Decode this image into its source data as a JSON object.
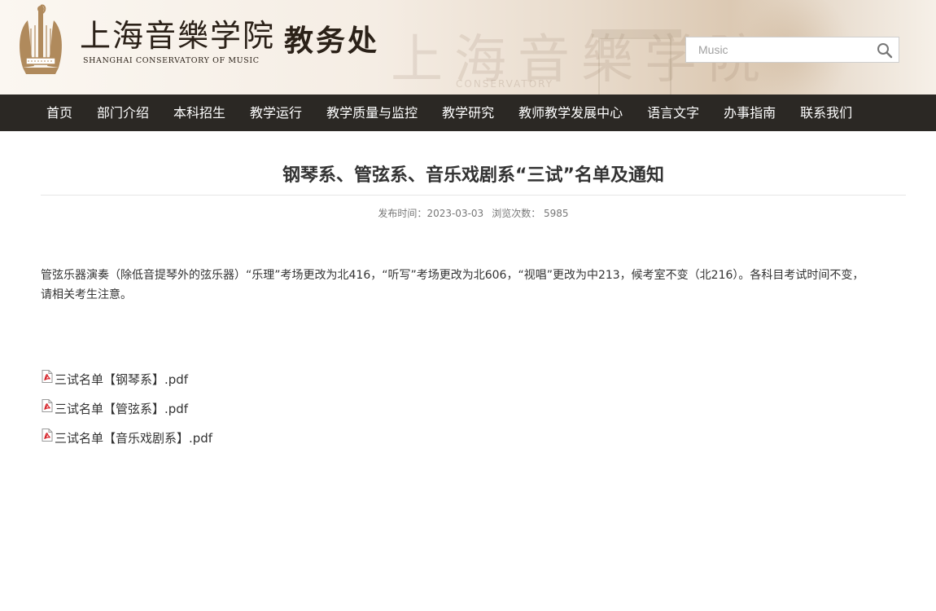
{
  "header": {
    "logo_cn": "上海音樂学院",
    "logo_en": "SHANGHAI CONSERVATORY OF MUSIC",
    "site_name": "教务处",
    "search": {
      "placeholder": "Music",
      "icon": "search-icon"
    }
  },
  "nav": {
    "items": [
      {
        "label": "首页"
      },
      {
        "label": "部门介绍"
      },
      {
        "label": "本科招生"
      },
      {
        "label": "教学运行"
      },
      {
        "label": "教学质量与监控"
      },
      {
        "label": "教学研究"
      },
      {
        "label": "教师教学发展中心"
      },
      {
        "label": "语言文字"
      },
      {
        "label": "办事指南"
      },
      {
        "label": "联系我们"
      }
    ]
  },
  "article": {
    "title": "钢琴系、管弦系、音乐戏剧系“三试”名单及通知",
    "publish_label": "发布时间：",
    "publish_date": "2023-03-03",
    "views_label": "浏览次数：",
    "views": "5985",
    "body_line1": "管弦乐器演奏（除低音提琴外的弦乐器）“乐理”考场更改为北416，“听写”考场更改为北606，“视唱”更改为中213，候考室不变（北216）。各科目考试时间不变，",
    "body_line2": "请相关考生注意。",
    "attachments": [
      {
        "label": "三试名单【钢琴系】.pdf",
        "icon": "pdf-icon"
      },
      {
        "label": "三试名单【管弦系】.pdf",
        "icon": "pdf-icon"
      },
      {
        "label": "三试名单【音乐戏剧系】.pdf",
        "icon": "pdf-icon"
      }
    ]
  },
  "colors": {
    "nav_bg": "#2b2824",
    "nav_text": "#ffffff",
    "logo_brown": "#b08a5c",
    "text_dark": "#333333"
  }
}
